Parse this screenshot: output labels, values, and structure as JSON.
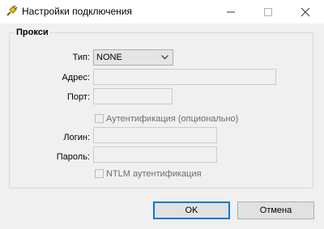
{
  "window": {
    "title": "Настройки подключения"
  },
  "proxy": {
    "group_title": "Прокси",
    "type_label": "Тип:",
    "type_value": "NONE",
    "address_label": "Адрес:",
    "port_label": "Порт:",
    "auth_label": "Аутентификация (опционально)",
    "login_label": "Логин:",
    "password_label": "Пароль:",
    "ntlm_label": "NTLM аутентификация"
  },
  "buttons": {
    "ok": "OK",
    "cancel": "Отмена"
  }
}
